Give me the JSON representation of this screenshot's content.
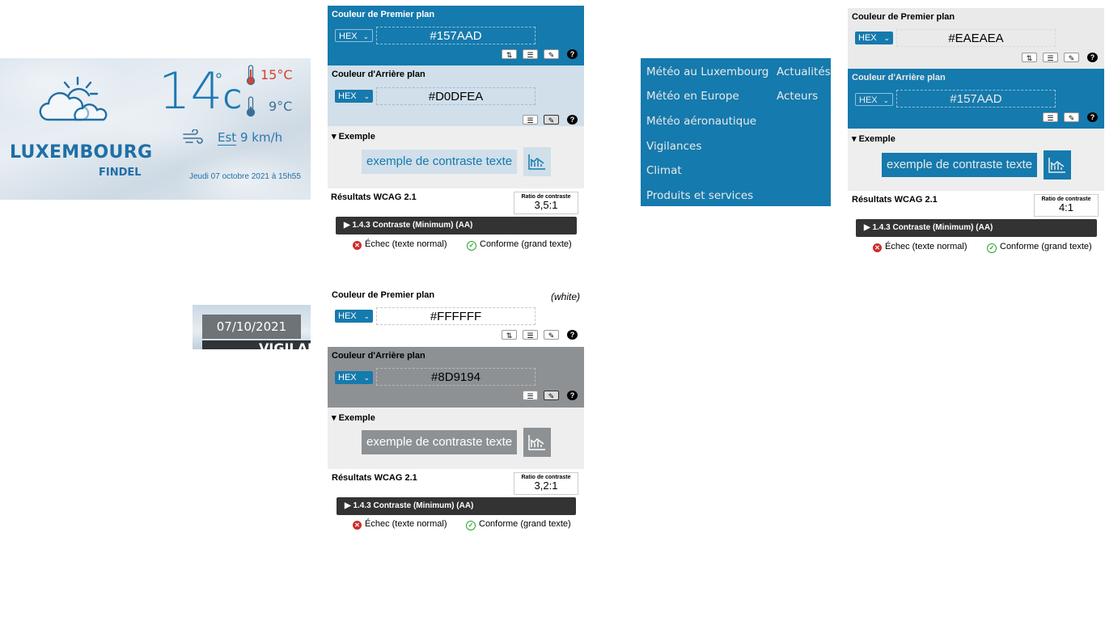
{
  "weather": {
    "city": "LUXEMBOURG",
    "station": "FINDEL",
    "temperature": "14",
    "degree_symbol": "°",
    "unit": "C",
    "temp_max": "15°C",
    "temp_min": "9°C",
    "wind_dir": "Est",
    "wind_speed": "9 km/h",
    "updated": "Jeudi 07 octobre 2021 à 15h55",
    "icon": "partly-cloudy-icon",
    "color": "#1d79b5"
  },
  "strip": {
    "date": "07/10/2021",
    "partial_text": "VIGILAN"
  },
  "panels": [
    {
      "fg_title": "Couleur de Premier plan",
      "fg_format": "HEX",
      "fg_value": "#157AAD",
      "bg_title": "Couleur d'Arrière plan",
      "bg_format": "HEX",
      "bg_value": "#D0DFEA",
      "example_title": "Exemple",
      "example_text": "exemple de contraste texte",
      "results_title": "Résultats WCAG 2.1",
      "ratio_label": "Ratio de contraste",
      "ratio_value": "3,5:1",
      "criterion": "1.4.3 Contraste (Minimum) (AA)",
      "normal_result": "Échec (texte normal)",
      "large_result": "Conforme (grand texte)",
      "fg_color": "#157AAD",
      "bg_color": "#D0DFEA"
    },
    {
      "fg_title": "Couleur de Premier plan",
      "fg_name": "(white)",
      "fg_format": "HEX",
      "fg_value": "#FFFFFF",
      "bg_title": "Couleur d'Arrière plan",
      "bg_format": "HEX",
      "bg_value": "#8D9194",
      "example_title": "Exemple",
      "example_text": "exemple de contraste texte",
      "results_title": "Résultats WCAG 2.1",
      "ratio_label": "Ratio de contraste",
      "ratio_value": "3,2:1",
      "criterion": "1.4.3 Contraste (Minimum) (AA)",
      "normal_result": "Échec (texte normal)",
      "large_result": "Conforme (grand texte)",
      "fg_color": "#FFFFFF",
      "bg_color": "#8D9194"
    },
    {
      "fg_title": "Couleur de Premier plan",
      "fg_format": "HEX",
      "fg_value": "#EAEAEA",
      "bg_title": "Couleur d'Arrière plan",
      "bg_format": "HEX",
      "bg_value": "#157AAD",
      "example_title": "Exemple",
      "example_text": "exemple de contraste texte",
      "results_title": "Résultats WCAG 2.1",
      "ratio_label": "Ratio de contraste",
      "ratio_value": "4:1",
      "criterion": "1.4.3 Contraste (Minimum) (AA)",
      "normal_result": "Échec (texte normal)",
      "large_result": "Conforme (grand texte)",
      "fg_color": "#EAEAEA",
      "bg_color": "#157AAD"
    }
  ],
  "nav": {
    "col1": [
      "Météo au Luxembourg",
      "Météo en Europe",
      "Météo aéronautique",
      "Vigilances",
      "Climat",
      "Produits et services"
    ],
    "col2": [
      "Actualités",
      "Acteurs"
    ],
    "bg_color": "#157AAD",
    "text_color": "#EAEAEA"
  }
}
